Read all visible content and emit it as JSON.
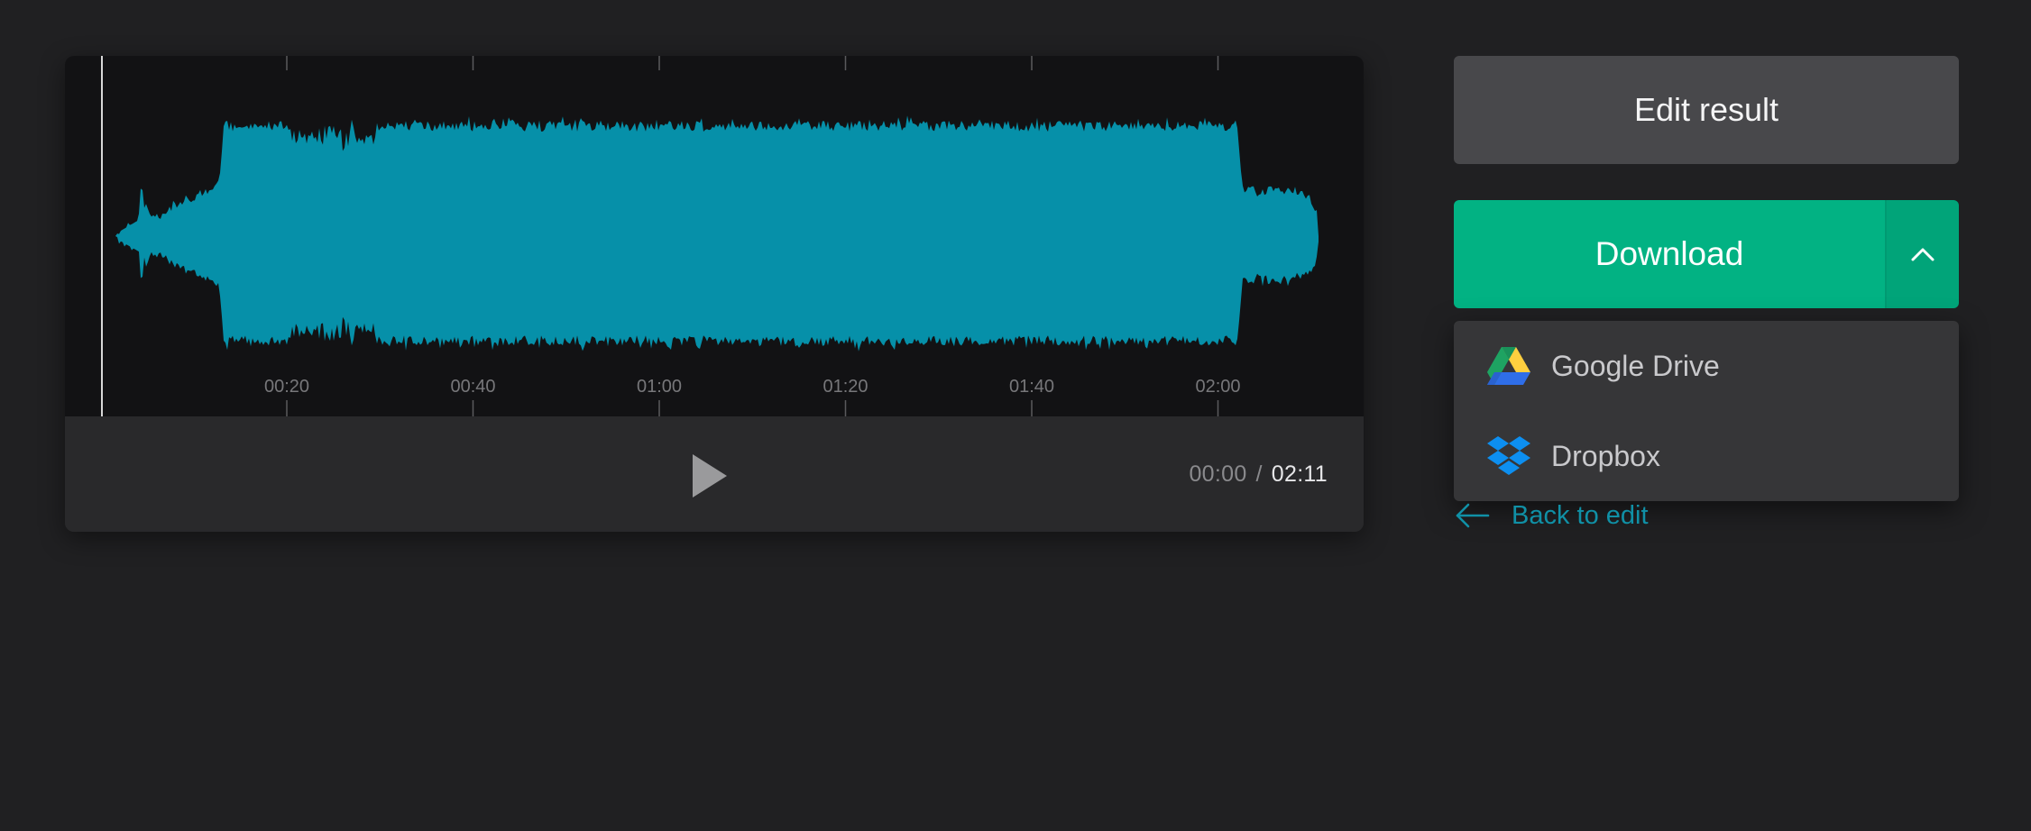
{
  "player": {
    "ticks": [
      "00:20",
      "00:40",
      "01:00",
      "01:20",
      "01:40",
      "02:00"
    ],
    "current_time": "00:00",
    "separator": "/",
    "duration": "02:11",
    "waveform_color": "#0690a9",
    "playhead_color": "#d8d8d8"
  },
  "actions": {
    "edit_label": "Edit result",
    "download_label": "Download",
    "dropdown": [
      {
        "label": "Google Drive",
        "icon": "google-drive-icon"
      },
      {
        "label": "Dropbox",
        "icon": "dropbox-icon"
      }
    ],
    "back_label": "Back to edit"
  },
  "colors": {
    "background": "#202022",
    "accent_green": "#02b283",
    "link_blue": "#1090a6"
  }
}
